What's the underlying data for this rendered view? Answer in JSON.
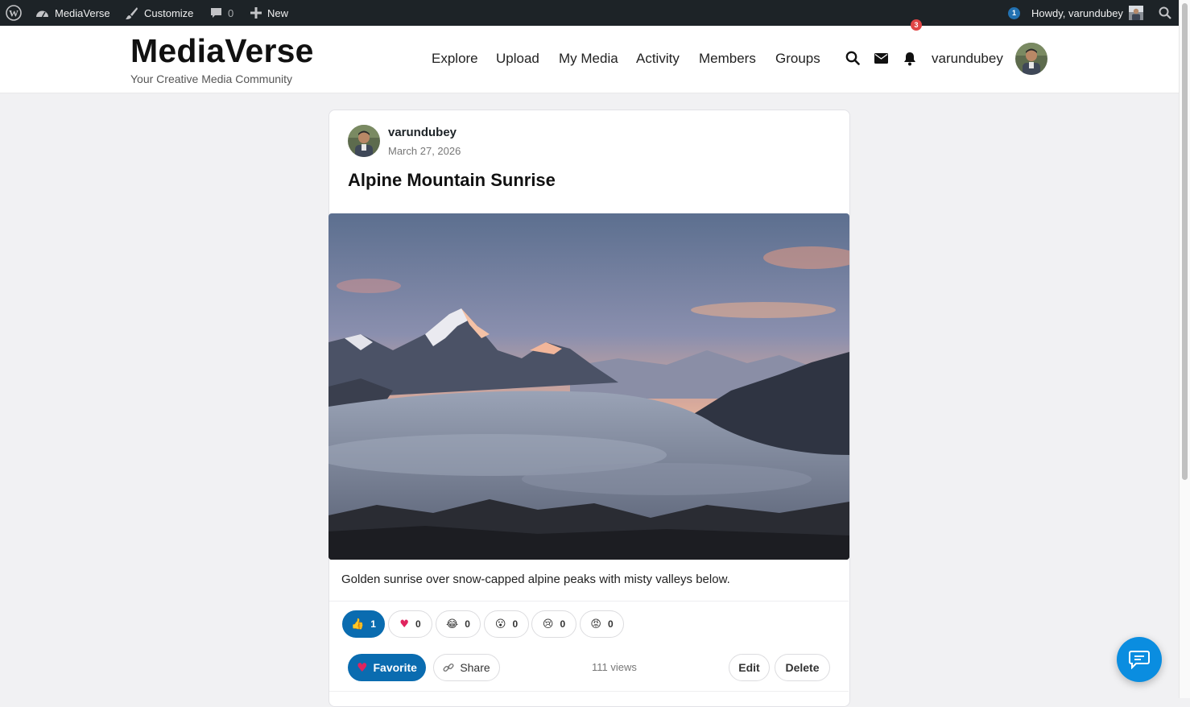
{
  "admin_bar": {
    "site_name": "MediaVerse",
    "customize": "Customize",
    "comments_count": "0",
    "new_label": "New",
    "notification_count": "1",
    "howdy": "Howdy, varundubey"
  },
  "header": {
    "site_title": "MediaVerse",
    "tagline": "Your Creative Media Community",
    "nav": [
      "Explore",
      "Upload",
      "My Media",
      "Activity",
      "Members",
      "Groups"
    ],
    "notification_badge": "3",
    "username": "varundubey"
  },
  "post": {
    "author": "varundubey",
    "date": "March 27, 2026",
    "title": "Alpine Mountain Sunrise",
    "caption": "Golden sunrise over snow-capped alpine peaks with misty valleys below.",
    "reactions": [
      {
        "icon": "thumbs-up-icon",
        "emoji": "👍",
        "count": "1",
        "active": true
      },
      {
        "icon": "heart-icon",
        "emoji": "♥",
        "count": "0",
        "active": false
      },
      {
        "icon": "laugh-icon",
        "emoji": "😂",
        "count": "0",
        "active": false
      },
      {
        "icon": "wow-icon",
        "emoji": "😮",
        "count": "0",
        "active": false
      },
      {
        "icon": "sad-icon",
        "emoji": "😢",
        "count": "0",
        "active": false
      },
      {
        "icon": "angry-icon",
        "emoji": "😡",
        "count": "0",
        "active": false
      }
    ],
    "favorite_label": "Favorite",
    "share_label": "Share",
    "views": "111 views",
    "edit_label": "Edit",
    "delete_label": "Delete"
  },
  "colors": {
    "accent": "#0a6cb0",
    "fab": "#0a8de0",
    "admin_bar": "#1d2327",
    "badge": "#e04545"
  }
}
